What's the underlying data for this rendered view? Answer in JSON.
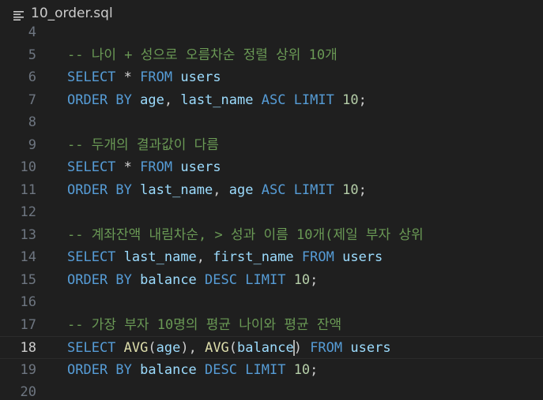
{
  "breadcrumb": {
    "icon": "lines-menu-icon",
    "filename": "10_order.sql"
  },
  "editor": {
    "active_line": 18,
    "lines": [
      {
        "number": "4",
        "tokens": []
      },
      {
        "number": "5",
        "tokens": [
          {
            "t": "comment",
            "text": "-- 나이 + 성으로 오름차순 정렬 상위 10개"
          }
        ]
      },
      {
        "number": "6",
        "tokens": [
          {
            "t": "keyword",
            "text": "SELECT"
          },
          {
            "t": "punct",
            "text": " "
          },
          {
            "t": "op",
            "text": "*"
          },
          {
            "t": "punct",
            "text": " "
          },
          {
            "t": "keyword",
            "text": "FROM"
          },
          {
            "t": "punct",
            "text": " "
          },
          {
            "t": "ident",
            "text": "users"
          }
        ]
      },
      {
        "number": "7",
        "tokens": [
          {
            "t": "keyword",
            "text": "ORDER BY"
          },
          {
            "t": "punct",
            "text": " "
          },
          {
            "t": "ident",
            "text": "age"
          },
          {
            "t": "punct",
            "text": ", "
          },
          {
            "t": "ident",
            "text": "last_name"
          },
          {
            "t": "punct",
            "text": " "
          },
          {
            "t": "keyword",
            "text": "ASC"
          },
          {
            "t": "punct",
            "text": " "
          },
          {
            "t": "keyword",
            "text": "LIMIT"
          },
          {
            "t": "punct",
            "text": " "
          },
          {
            "t": "number",
            "text": "10"
          },
          {
            "t": "punct",
            "text": ";"
          }
        ]
      },
      {
        "number": "8",
        "tokens": []
      },
      {
        "number": "9",
        "tokens": [
          {
            "t": "comment",
            "text": "-- 두개의 결과값이 다름"
          }
        ]
      },
      {
        "number": "10",
        "tokens": [
          {
            "t": "keyword",
            "text": "SELECT"
          },
          {
            "t": "punct",
            "text": " "
          },
          {
            "t": "op",
            "text": "*"
          },
          {
            "t": "punct",
            "text": " "
          },
          {
            "t": "keyword",
            "text": "FROM"
          },
          {
            "t": "punct",
            "text": " "
          },
          {
            "t": "ident",
            "text": "users"
          }
        ]
      },
      {
        "number": "11",
        "tokens": [
          {
            "t": "keyword",
            "text": "ORDER BY"
          },
          {
            "t": "punct",
            "text": " "
          },
          {
            "t": "ident",
            "text": "last_name"
          },
          {
            "t": "punct",
            "text": ", "
          },
          {
            "t": "ident",
            "text": "age"
          },
          {
            "t": "punct",
            "text": " "
          },
          {
            "t": "keyword",
            "text": "ASC"
          },
          {
            "t": "punct",
            "text": " "
          },
          {
            "t": "keyword",
            "text": "LIMIT"
          },
          {
            "t": "punct",
            "text": " "
          },
          {
            "t": "number",
            "text": "10"
          },
          {
            "t": "punct",
            "text": ";"
          }
        ]
      },
      {
        "number": "12",
        "tokens": []
      },
      {
        "number": "13",
        "tokens": [
          {
            "t": "comment",
            "text": "-- 계좌잔액 내림차순, > 성과 이름 10개(제일 부자 상위"
          }
        ]
      },
      {
        "number": "14",
        "tokens": [
          {
            "t": "keyword",
            "text": "SELECT"
          },
          {
            "t": "punct",
            "text": " "
          },
          {
            "t": "ident",
            "text": "last_name"
          },
          {
            "t": "punct",
            "text": ", "
          },
          {
            "t": "ident",
            "text": "first_name"
          },
          {
            "t": "punct",
            "text": " "
          },
          {
            "t": "keyword",
            "text": "FROM"
          },
          {
            "t": "punct",
            "text": " "
          },
          {
            "t": "ident",
            "text": "users"
          }
        ]
      },
      {
        "number": "15",
        "tokens": [
          {
            "t": "keyword",
            "text": "ORDER BY"
          },
          {
            "t": "punct",
            "text": " "
          },
          {
            "t": "ident",
            "text": "balance"
          },
          {
            "t": "punct",
            "text": " "
          },
          {
            "t": "keyword",
            "text": "DESC"
          },
          {
            "t": "punct",
            "text": " "
          },
          {
            "t": "keyword",
            "text": "LIMIT"
          },
          {
            "t": "punct",
            "text": " "
          },
          {
            "t": "number",
            "text": "10"
          },
          {
            "t": "punct",
            "text": ";"
          }
        ]
      },
      {
        "number": "16",
        "tokens": []
      },
      {
        "number": "17",
        "tokens": [
          {
            "t": "comment",
            "text": "-- 가장 부자 10명의 평균 나이와 평균 잔액"
          }
        ]
      },
      {
        "number": "18",
        "tokens": [
          {
            "t": "keyword",
            "text": "SELECT"
          },
          {
            "t": "punct",
            "text": " "
          },
          {
            "t": "func",
            "text": "AVG"
          },
          {
            "t": "punct",
            "text": "("
          },
          {
            "t": "ident",
            "text": "age"
          },
          {
            "t": "punct",
            "text": "), "
          },
          {
            "t": "func",
            "text": "AVG"
          },
          {
            "t": "punct",
            "text": "("
          },
          {
            "t": "ident",
            "text": "balance"
          },
          {
            "t": "cursor",
            "text": ""
          },
          {
            "t": "punct",
            "text": ") "
          },
          {
            "t": "keyword",
            "text": "FROM"
          },
          {
            "t": "punct",
            "text": " "
          },
          {
            "t": "ident",
            "text": "users"
          }
        ]
      },
      {
        "number": "19",
        "tokens": [
          {
            "t": "keyword",
            "text": "ORDER BY"
          },
          {
            "t": "punct",
            "text": " "
          },
          {
            "t": "ident",
            "text": "balance"
          },
          {
            "t": "punct",
            "text": " "
          },
          {
            "t": "keyword",
            "text": "DESC"
          },
          {
            "t": "punct",
            "text": " "
          },
          {
            "t": "keyword",
            "text": "LIMIT"
          },
          {
            "t": "punct",
            "text": " "
          },
          {
            "t": "number",
            "text": "10"
          },
          {
            "t": "punct",
            "text": ";"
          }
        ]
      },
      {
        "number": "20",
        "tokens": []
      }
    ]
  },
  "colors": {
    "background": "#1f1f1f",
    "comment": "#6a9955",
    "keyword": "#569cd6",
    "identifier": "#9cdcfe",
    "number": "#b5cea8",
    "function": "#dcdcaa",
    "line_number": "#6e7681",
    "active_line_number": "#cccccc"
  }
}
